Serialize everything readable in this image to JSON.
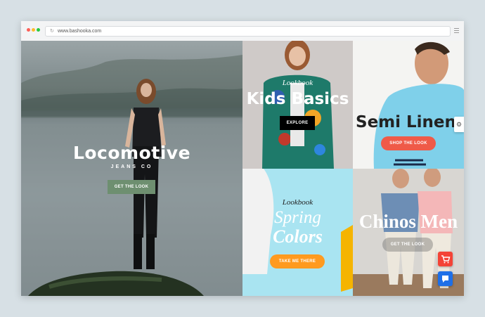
{
  "browser": {
    "url": "www.bashooka.com",
    "dots": [
      "#fc5f57",
      "#fdbb2e",
      "#28c840"
    ]
  },
  "panels": {
    "locomotive": {
      "title": "Locomotive",
      "subtitle": "JEANS CO",
      "button": "GET THE LOOK"
    },
    "kids": {
      "kicker": "Lookbook",
      "title": "Kids Basics",
      "button": "EXPLORE"
    },
    "semi": {
      "title": "Semi Linen",
      "button": "SHOP THE LOOK"
    },
    "spring": {
      "kicker": "Lookbook",
      "title_line1": "Spring",
      "title_line2": "Colors",
      "button": "TAKE ME THERE"
    },
    "chinos": {
      "title": "Chinos Men",
      "button": "GET THE LOOK"
    }
  },
  "colors": {
    "accent_green": "#6e8f70",
    "accent_orange": "#ff9a1f",
    "accent_coral": "#ef5a48",
    "cart_red": "#f44336",
    "chat_blue": "#1e6fe8"
  },
  "icons": {
    "reload": "reload-icon",
    "menu": "menu-icon",
    "settings": "gear-icon",
    "cart": "cart-icon",
    "chat": "chat-icon"
  }
}
